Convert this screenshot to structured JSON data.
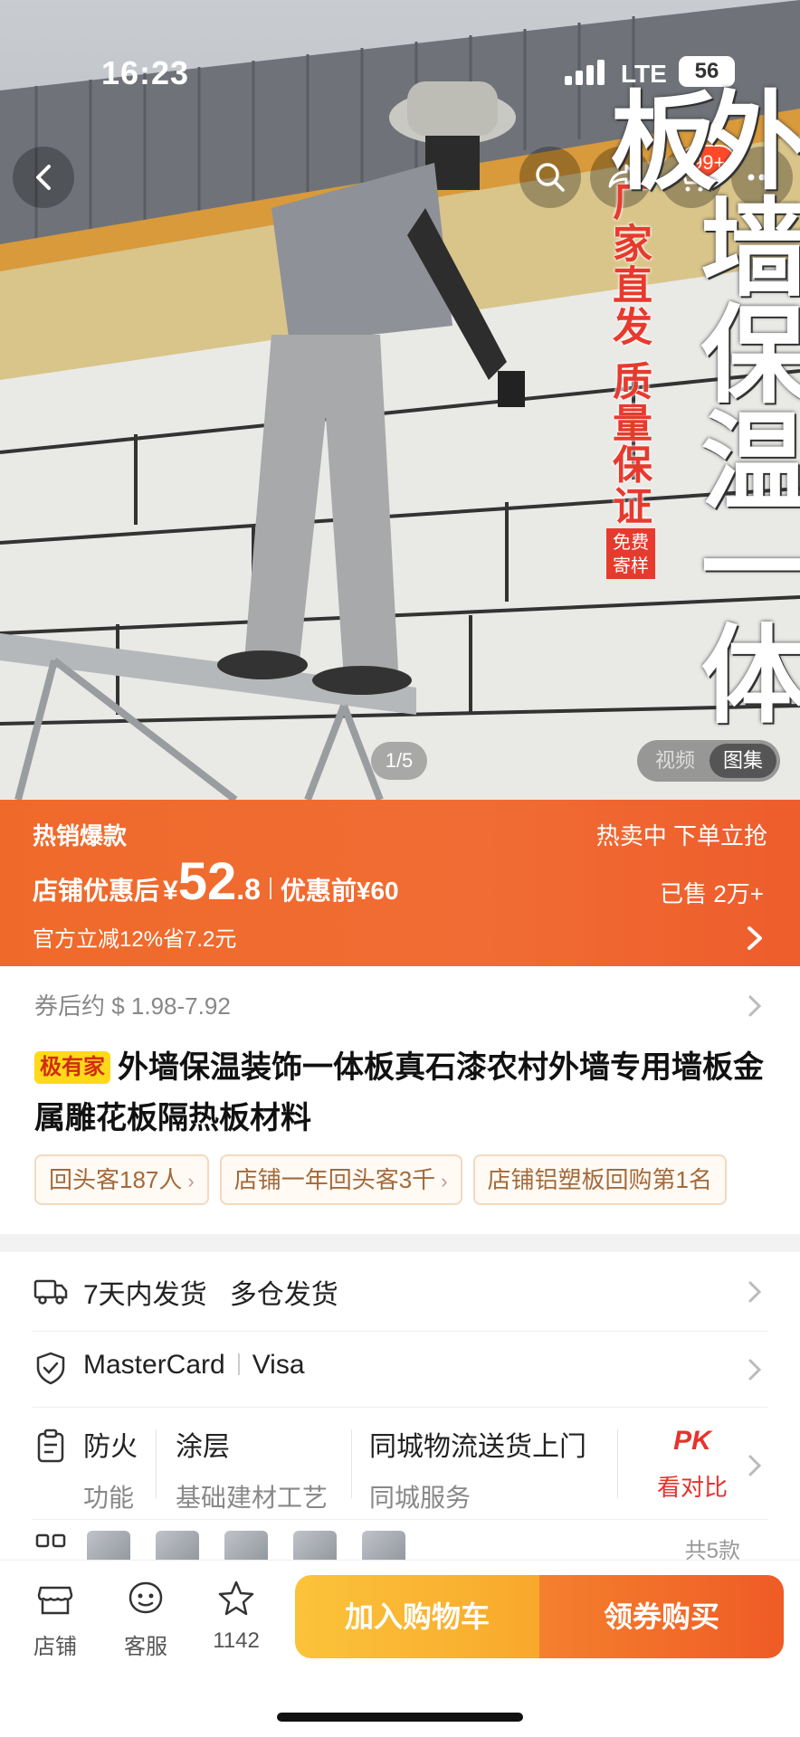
{
  "status": {
    "time": "16:23",
    "network": "LTE",
    "battery": "56"
  },
  "hero": {
    "cart_badge": "99+",
    "promo_vertical": "厂家直发 质量保证",
    "promo_small": "免费寄样",
    "big_title": "外墙保温一体板",
    "page_indicator": "1/5",
    "media_video": "视频",
    "media_gallery": "图集"
  },
  "banner": {
    "hot_label": "热销爆款",
    "rush_label": "热卖中 下单立抢",
    "price_label": "店铺优惠后",
    "currency": "¥",
    "price_int": "52",
    "price_dec": ".8",
    "orig_price": "优惠前¥60",
    "sold": "已售 2万+",
    "official_cut": "官方立减12%省7.2元"
  },
  "product": {
    "coupon_text": "券后约 $ 1.98-7.92",
    "tag": "极有家",
    "title": "外墙保温装饰一体板真石漆农村外墙专用墙板金属雕花板隔热板材料",
    "chips": [
      "回头客187人",
      "店铺一年回头客3千",
      "店铺铝塑板回购第1名"
    ]
  },
  "details": {
    "shipping": "7天内发货   多仓发货",
    "pay_1": "MasterCard",
    "pay_2": "Visa",
    "attrs": [
      {
        "value": "防火",
        "label": "功能"
      },
      {
        "value": "涂层",
        "label": "基础建材工艺"
      },
      {
        "value": "同城物流送货上门",
        "label": "同城服务"
      }
    ],
    "pk_value": "PK",
    "pk_label": "看对比",
    "styles_count": "共5款"
  },
  "bottom_bar": {
    "shop": "店铺",
    "service": "客服",
    "favorites": "1142",
    "add_cart": "加入购物车",
    "buy": "领券购买"
  },
  "colors": {
    "accent": "#ef6a2a",
    "cart_btn": "#fbc33a",
    "buy_btn": "#ef5b25",
    "pk": "#e8322d"
  }
}
